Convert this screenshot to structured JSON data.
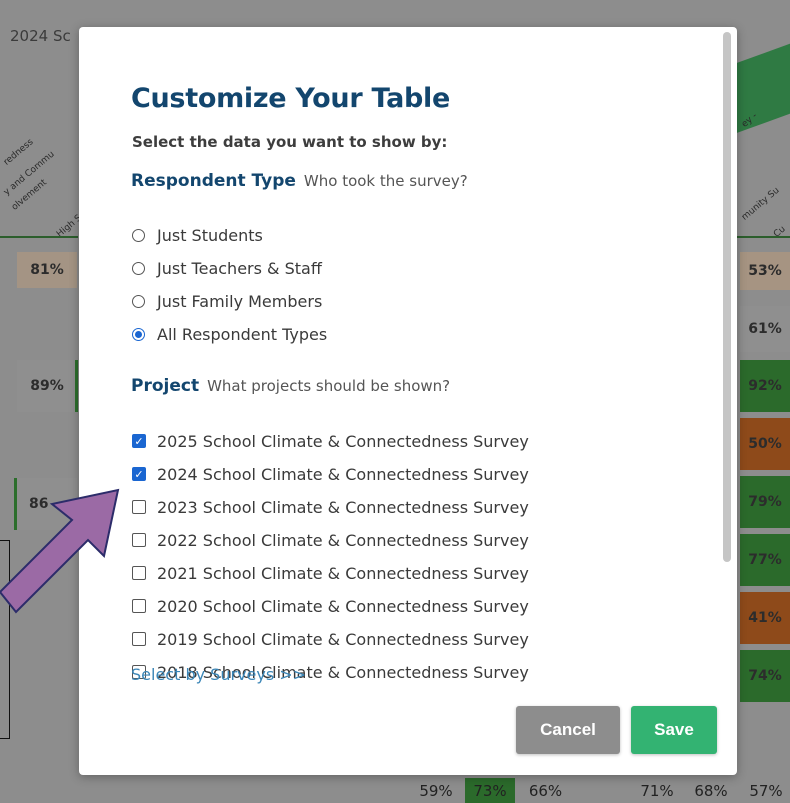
{
  "background": {
    "title": "2024 Sc",
    "column_labels_left": [
      "redness",
      "y and Commu",
      "olvement",
      "High S"
    ],
    "column_labels_right": [
      "ey -",
      "munity Su",
      "Cu"
    ],
    "left_cells": [
      "81%",
      "89%",
      "86"
    ],
    "right_cells": [
      {
        "value": "53%",
        "color": "#c7a98f"
      },
      {
        "value": "61%",
        "color": "#9a9a9a"
      },
      {
        "value": "92%",
        "color": "#2c6e2c"
      },
      {
        "value": "50%",
        "color": "#a24a18"
      },
      {
        "value": "79%",
        "color": "#2c6e2c"
      },
      {
        "value": "77%",
        "color": "#2c6e2c"
      },
      {
        "value": "41%",
        "color": "#a24a18"
      },
      {
        "value": "74%",
        "color": "#2c6e2c"
      }
    ],
    "bottom_cells": [
      "59%",
      "73%",
      "66%",
      "71%",
      "68%",
      "57%"
    ]
  },
  "modal": {
    "title": "Customize Your Table",
    "subtitle": "Select the data you want to show by:",
    "respondent_section": {
      "heading": "Respondent Type",
      "hint": "Who took the survey?",
      "options": [
        {
          "label": "Just Students",
          "checked": false
        },
        {
          "label": "Just Teachers & Staff",
          "checked": false
        },
        {
          "label": "Just Family Members",
          "checked": false
        },
        {
          "label": "All Respondent Types",
          "checked": true
        }
      ]
    },
    "project_section": {
      "heading": "Project",
      "hint": "What projects should be shown?",
      "options": [
        {
          "label": "2025 School Climate & Connectedness Survey",
          "checked": true
        },
        {
          "label": "2024 School Climate & Connectedness Survey",
          "checked": true
        },
        {
          "label": "2023 School Climate & Connectedness Survey",
          "checked": false
        },
        {
          "label": "2022 School Climate & Connectedness Survey",
          "checked": false
        },
        {
          "label": "2021 School Climate & Connectedness Survey",
          "checked": false
        },
        {
          "label": "2020 School Climate & Connectedness Survey",
          "checked": false
        },
        {
          "label": "2019 School Climate & Connectedness Survey",
          "checked": false
        },
        {
          "label": "2018 School Climate & Connectedness Survey",
          "checked": false
        }
      ]
    },
    "select_by_surveys_link": "Select by Surveys >>",
    "cancel_label": "Cancel",
    "save_label": "Save"
  },
  "colors": {
    "title_blue": "#13466e",
    "checkbox_blue": "#1a66d1",
    "save_green": "#33b372",
    "cancel_gray": "#8d8d8d",
    "arrow_purple": "#9b6aa5"
  }
}
